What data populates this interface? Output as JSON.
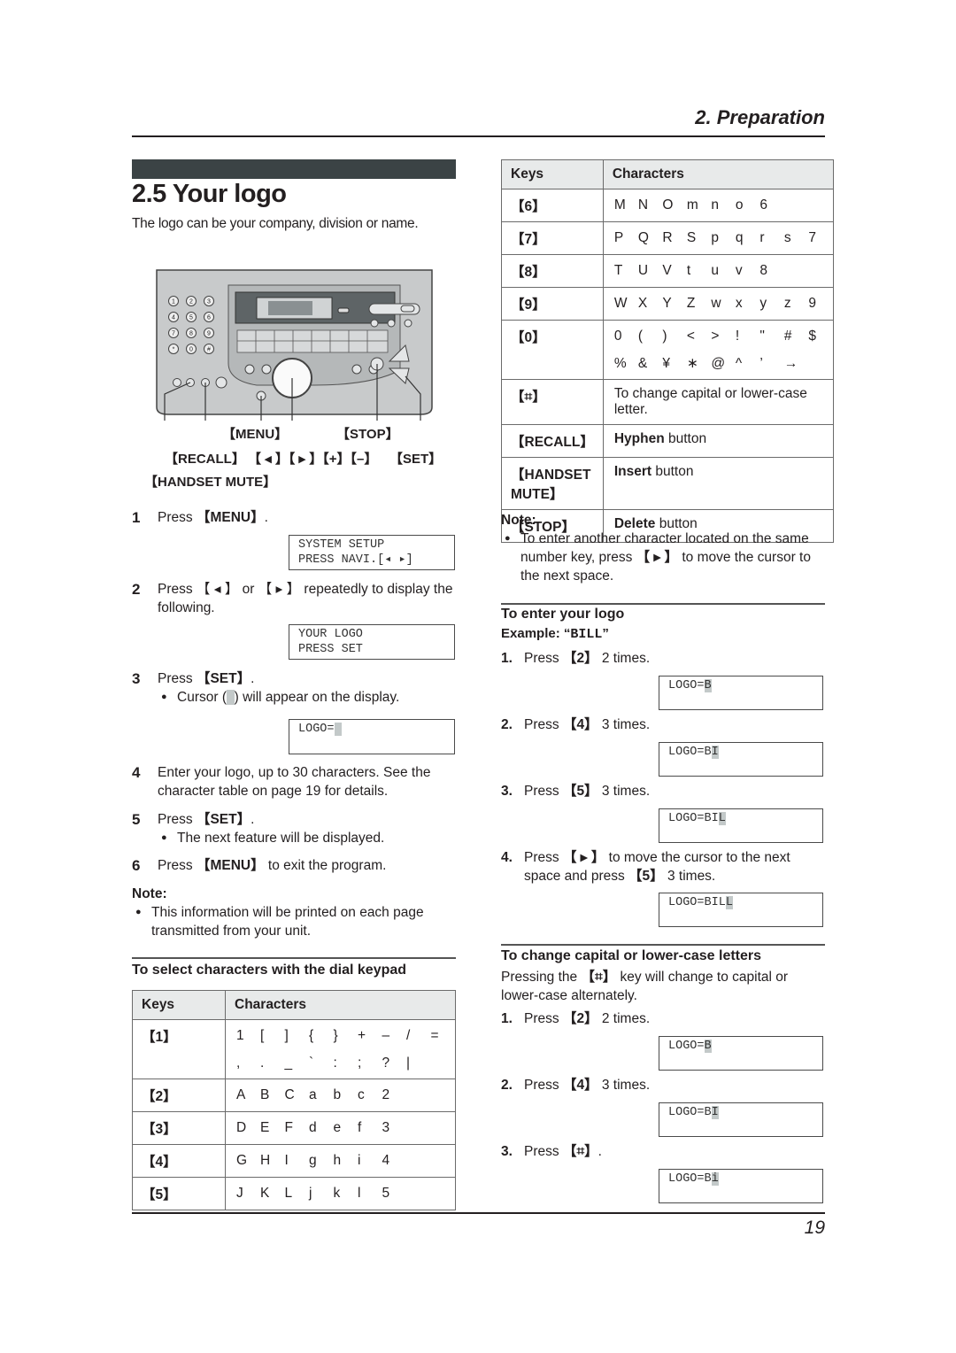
{
  "header": {
    "section": "2. Preparation"
  },
  "title": "2.5 Your logo",
  "intro": "The logo can be your company, division or name.",
  "illustration": {
    "keypad": [
      "1",
      "2",
      "3",
      "4",
      "5",
      "6",
      "7",
      "8",
      "9",
      "*",
      "0",
      "#"
    ],
    "callouts": {
      "menu": "【MENU】",
      "stop": "【STOP】",
      "recall": "【RECALL】",
      "navi": "【 ◂ 】【 ▸ 】【+】【–】",
      "set": "【SET】",
      "handset_mute": "【HANDSET MUTE】"
    }
  },
  "steps": [
    {
      "num": "1",
      "pre": "Press ",
      "key": "【MENU】",
      "post": ".",
      "lcd": [
        "SYSTEM SETUP",
        "PRESS NAVI.[◂ ▸]"
      ]
    },
    {
      "num": "2",
      "text": "Press 【 ◂ 】 or 【 ▸ 】 repeatedly to display the following.",
      "lcd": [
        "YOUR LOGO",
        "PRESS SET"
      ]
    },
    {
      "num": "3",
      "pre": "Press ",
      "key": "【SET】",
      "post": ".",
      "bullet_pre": "Cursor (",
      "bullet_post": ") will appear on the display.",
      "lcd_prefix": "LOGO="
    },
    {
      "num": "4",
      "text": "Enter your logo, up to 30 characters. See the character table on page 19 for details."
    },
    {
      "num": "5",
      "pre": "Press ",
      "key": "【SET】",
      "post": ".",
      "bullet": "The next feature will be displayed."
    },
    {
      "num": "6",
      "pre": "Press ",
      "key": "【MENU】",
      "post": " to exit the program."
    }
  ],
  "note_left": {
    "label": "Note:",
    "text": "This information will be printed on each page transmitted from your unit."
  },
  "dial_keypad": {
    "heading": "To select characters with the dial keypad",
    "col_keys": "Keys",
    "col_chars": "Characters",
    "rows": [
      {
        "key": "【1】",
        "lines": [
          [
            "1",
            "[",
            "]",
            "{",
            "}",
            "+",
            "–",
            "/",
            "="
          ],
          [
            ",",
            ".",
            "_",
            "`",
            ":",
            ";",
            "?",
            "|"
          ]
        ]
      },
      {
        "key": "【2】",
        "lines": [
          [
            "A",
            "B",
            "C",
            "a",
            "b",
            "c",
            "2"
          ]
        ]
      },
      {
        "key": "【3】",
        "lines": [
          [
            "D",
            "E",
            "F",
            "d",
            "e",
            "f",
            "3"
          ]
        ]
      },
      {
        "key": "【4】",
        "lines": [
          [
            "G",
            "H",
            "I",
            "g",
            "h",
            "i",
            "4"
          ]
        ]
      },
      {
        "key": "【5】",
        "lines": [
          [
            "J",
            "K",
            "L",
            "j",
            "k",
            "l",
            "5"
          ]
        ]
      }
    ]
  },
  "table_right": {
    "col_keys": "Keys",
    "col_chars": "Characters",
    "rows": [
      {
        "key": "【6】",
        "lines": [
          [
            "M",
            "N",
            "O",
            "m",
            "n",
            "o",
            "6"
          ]
        ]
      },
      {
        "key": "【7】",
        "lines": [
          [
            "P",
            "Q",
            "R",
            "S",
            "p",
            "q",
            "r",
            "s",
            "7"
          ]
        ]
      },
      {
        "key": "【8】",
        "lines": [
          [
            "T",
            "U",
            "V",
            "t",
            "u",
            "v",
            "8"
          ]
        ]
      },
      {
        "key": "【9】",
        "lines": [
          [
            "W",
            "X",
            "Y",
            "Z",
            "w",
            "x",
            "y",
            "z",
            "9"
          ]
        ]
      },
      {
        "key": "【0】",
        "lines": [
          [
            "0",
            "(",
            ")",
            "<",
            ">",
            "!",
            "\"",
            "#",
            "$"
          ],
          [
            "%",
            "&",
            "¥",
            "∗",
            "@",
            "^",
            "’",
            "→"
          ]
        ]
      }
    ],
    "func_rows": [
      {
        "key": "【⌗】",
        "bold": "",
        "text": "To change capital or lower-case letter."
      },
      {
        "key": "【RECALL】",
        "bold": "Hyphen",
        "text": " button"
      },
      {
        "key": "【HANDSET MUTE】",
        "bold": "Insert",
        "text": " button"
      },
      {
        "key": "【STOP】",
        "bold": "Delete",
        "text": " button"
      }
    ]
  },
  "note_right": {
    "label": "Note:",
    "pre": "To enter another character located on the same number key, press ",
    "key": "【 ▸ 】",
    "post": " to move the cursor to the next space."
  },
  "enter_logo": {
    "heading": "To enter your logo",
    "example_label": "Example: “",
    "example_value": "BILL",
    "example_close": "”",
    "steps": [
      {
        "num": "1.",
        "pre": "Press ",
        "key": "【2】",
        "post": " 2 times.",
        "lcd_text": "LOGO=",
        "lcd_cursor": "B"
      },
      {
        "num": "2.",
        "pre": "Press ",
        "key": "【4】",
        "post": " 3 times.",
        "lcd_text": "LOGO=B",
        "lcd_cursor": "I"
      },
      {
        "num": "3.",
        "pre": "Press ",
        "key": "【5】",
        "post": " 3 times.",
        "lcd_text": "LOGO=BI",
        "lcd_cursor": "L"
      },
      {
        "num": "4.",
        "pre": "Press ",
        "key": "【 ▸ 】",
        "mid": " to move the cursor to the next space and press ",
        "key2": "【5】",
        "post": " 3 times.",
        "lcd_text": "LOGO=BIL",
        "lcd_cursor": "L"
      }
    ]
  },
  "change_case": {
    "heading": "To change capital or lower-case letters",
    "desc_pre": "Pressing the ",
    "desc_key": "【⌗】",
    "desc_post": " key will change to capital or lower-case alternately.",
    "steps": [
      {
        "num": "1.",
        "pre": "Press ",
        "key": "【2】",
        "post": " 2 times.",
        "lcd_text": "LOGO=",
        "lcd_cursor": "B"
      },
      {
        "num": "2.",
        "pre": "Press ",
        "key": "【4】",
        "post": " 3 times.",
        "lcd_text": "LOGO=B",
        "lcd_cursor": "I"
      },
      {
        "num": "3.",
        "pre": "Press ",
        "key": "【⌗】",
        "post": ".",
        "lcd_text": "LOGO=B",
        "lcd_cursor": "i"
      }
    ]
  },
  "page_number": "19"
}
